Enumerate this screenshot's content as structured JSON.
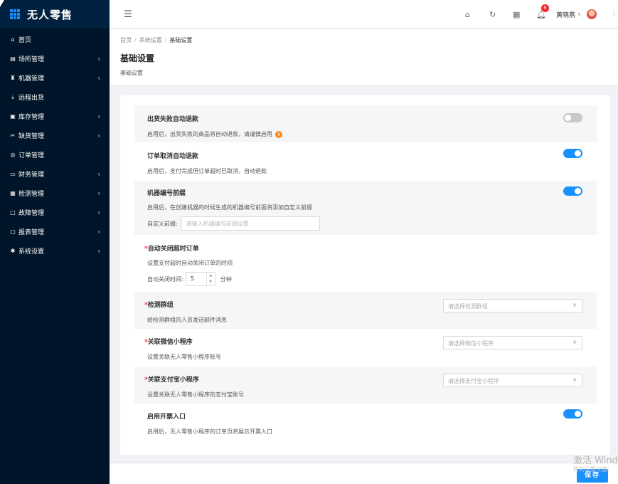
{
  "app": {
    "title": "无人零售"
  },
  "sidebar": {
    "items": [
      {
        "label": "首页",
        "icon": "home-icon",
        "glyph": "⌂",
        "has_arrow": false
      },
      {
        "label": "场所管理",
        "icon": "venue-icon",
        "glyph": "▤",
        "has_arrow": true
      },
      {
        "label": "机器管理",
        "icon": "machine-icon",
        "glyph": "♜",
        "has_arrow": true
      },
      {
        "label": "远程出货",
        "icon": "remote-ship-icon",
        "glyph": "⇣",
        "has_arrow": false
      },
      {
        "label": "库存管理",
        "icon": "inventory-icon",
        "glyph": "▣",
        "has_arrow": true
      },
      {
        "label": "缺货管理",
        "icon": "shortage-icon",
        "glyph": "✂",
        "has_arrow": true
      },
      {
        "label": "订单管理",
        "icon": "order-icon",
        "glyph": "◎",
        "has_arrow": false
      },
      {
        "label": "财务管理",
        "icon": "finance-icon",
        "glyph": "▭",
        "has_arrow": true
      },
      {
        "label": "检测管理",
        "icon": "inspection-icon",
        "glyph": "▦",
        "has_arrow": true
      },
      {
        "label": "故障管理",
        "icon": "fault-icon",
        "glyph": "□",
        "has_arrow": true
      },
      {
        "label": "报表管理",
        "icon": "report-icon",
        "glyph": "▢",
        "has_arrow": true
      },
      {
        "label": "系统设置",
        "icon": "settings-icon",
        "glyph": "✱",
        "has_arrow": true
      }
    ]
  },
  "header": {
    "notification_count": "6",
    "user_name": "黄晓燕"
  },
  "breadcrumb": [
    "首页",
    "系统设置",
    "基础设置"
  ],
  "page": {
    "title": "基础设置",
    "subtitle": "基础设置"
  },
  "settings": {
    "auto_refund_fail": {
      "title": "出货失败自动退款",
      "desc": "启用后，出货失败的商品将自动退款，请谨慎启用",
      "enabled": false
    },
    "cancel_refund": {
      "title": "订单取消自动退款",
      "desc": "启用后，支付完成但订单超时已取消，自动退款",
      "enabled": true
    },
    "machine_prefix": {
      "title": "机器编号前缀",
      "desc": "启用后，在创建机器的时候生成的机器编号前面将添加自定义前缀",
      "field_label": "自定义前缀:",
      "placeholder": "请输入机器编号前缀设置",
      "enabled": true
    },
    "auto_close": {
      "required": "*",
      "title": "自动关闭超时订单",
      "desc": "设置支付超时自动关闭订单的时间",
      "field_label": "自动关闭时间:",
      "value": "5",
      "unit": "分钟"
    },
    "inspection_group": {
      "required": "*",
      "title": "检测群组",
      "desc": "给检测群组的人员发送邮件消息",
      "placeholder": "请选择检测群组"
    },
    "wechat_mini": {
      "required": "*",
      "title": "关联微信小程序",
      "desc": "设置关联无人零售小程序账号",
      "placeholder": "请选择微信小程序"
    },
    "alipay_mini": {
      "required": "*",
      "title": "关联支付宝小程序",
      "desc": "设置关联无人零售小程序的支付宝账号",
      "placeholder": "请选择支付宝小程序"
    },
    "invoice": {
      "title": "启用开票入口",
      "desc": "启用后，无人零售小程序的订单页将展示开票入口",
      "enabled": true
    }
  },
  "footer": {
    "save_label": "保存"
  },
  "watermark": {
    "line1": "激活 Windows",
    "line2": "转到设置以激活 Windows"
  },
  "colors": {
    "sidebar_bg": "#001529",
    "accent": "#1890ff",
    "warning": "#fa8c16"
  }
}
